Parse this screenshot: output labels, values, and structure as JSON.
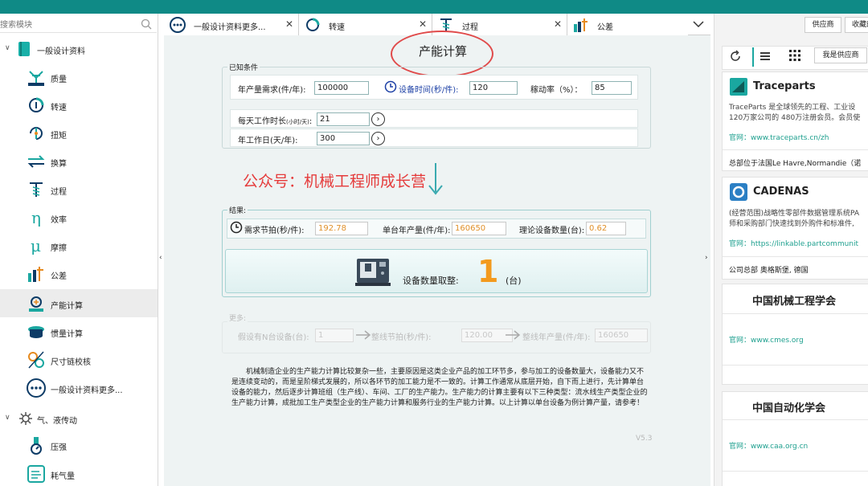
{
  "sidebar": {
    "search_placeholder": "搜索模块",
    "groups": [
      {
        "label": "一般设计资料"
      },
      {
        "label": "气、液传动"
      }
    ],
    "items": [
      {
        "label": "质量"
      },
      {
        "label": "转速"
      },
      {
        "label": "扭矩"
      },
      {
        "label": "换算"
      },
      {
        "label": "过程"
      },
      {
        "label": "效率"
      },
      {
        "label": "摩擦"
      },
      {
        "label": "公差"
      },
      {
        "label": "产能计算"
      },
      {
        "label": "惯量计算"
      },
      {
        "label": "尺寸链校核"
      },
      {
        "label": "一般设计资料更多..."
      },
      {
        "label": "压强"
      },
      {
        "label": "耗气量"
      }
    ]
  },
  "tabs": [
    {
      "label": "一般设计资料更多..."
    },
    {
      "label": "转速"
    },
    {
      "label": "过程"
    },
    {
      "label": "公差"
    }
  ],
  "main": {
    "title": "产能计算",
    "known": {
      "legend": "已知条件",
      "annual_demand_label": "年产量需求(件/年):",
      "annual_demand_value": "100000",
      "equip_time_label": "设备时间(秒/件):",
      "equip_time_value": "120",
      "utilization_label": "稼动率（%）：",
      "utilization_value": "85",
      "daily_hours_label": "每天工作时长",
      "daily_hours_small": "(小时/天)",
      "daily_hours_value": "21",
      "work_days_label": "年工作日(天/年):",
      "work_days_value": "300"
    },
    "watermark": "公众号：机械工程师成长营",
    "result": {
      "legend": "结果:",
      "takt_label": "需求节拍(秒/件):",
      "takt_value": "192.78",
      "single_output_label": "单台年产量(件/年):",
      "single_output_value": "160650",
      "theory_label": "理论设备数量(台):",
      "theory_value": "0.62",
      "rounded_label": "设备数量取整:",
      "rounded_value": "1",
      "rounded_unit": "(台)"
    },
    "more": {
      "legend": "更多:",
      "n_label": "假设有N台设备(台):",
      "n_value": "1",
      "line_takt_label": "整线节拍(秒/件):",
      "line_takt_value": "120.00",
      "line_output_label": "整线年产量(件/年):",
      "line_output_value": "160650"
    },
    "description": "机械制造企业的生产能力计算比较复杂一些，主要原因是这类企业产品的加工环节多，参与加工的设备数量大，设备能力又不是连续变动的，而是呈阶梯式发展的，所以各环节的加工能力是不一致的。计算工作通常从底层开始，自下而上进行，先计算单台设备的能力，然后逐步计算班组（生产线）、车间、工厂的生产能力。生产能力的计算主要有以下三种类型：流水线生产类型企业的生产能力计算，成批加工生产类型企业的生产能力计算和服务行业的生产能力计算。以上计算以单台设备为例计算产量，请参考！",
    "version": "V5.3"
  },
  "right": {
    "tabs": {
      "supplier": "供应商",
      "favorites": "收藏的"
    },
    "i_am_supplier": "我是供应商",
    "cards": [
      {
        "title": "Traceparts",
        "desc1": "TraceParts 是全球领先的工程、工业设",
        "desc2": "120万家公司的 480万注册会员。会员使",
        "url": "官网：www.traceparts.cn/zh",
        "foot": "总部位于法国Le Havre,Normandie（诺"
      },
      {
        "title": "CADENAS",
        "desc1": "(经营范围)战略性零部件数据管理系统PA",
        "desc2": "师和采购部门快速找到外购件和标准件,",
        "url": "官网：https://linkable.partcommunit",
        "foot": "公司总部  奥格斯堡, 德国"
      },
      {
        "title": "中国机械工程学会",
        "url": "官网：www.cmes.org"
      },
      {
        "title": "中国自动化学会",
        "url": "官网：www.caa.org.cn"
      }
    ]
  }
}
